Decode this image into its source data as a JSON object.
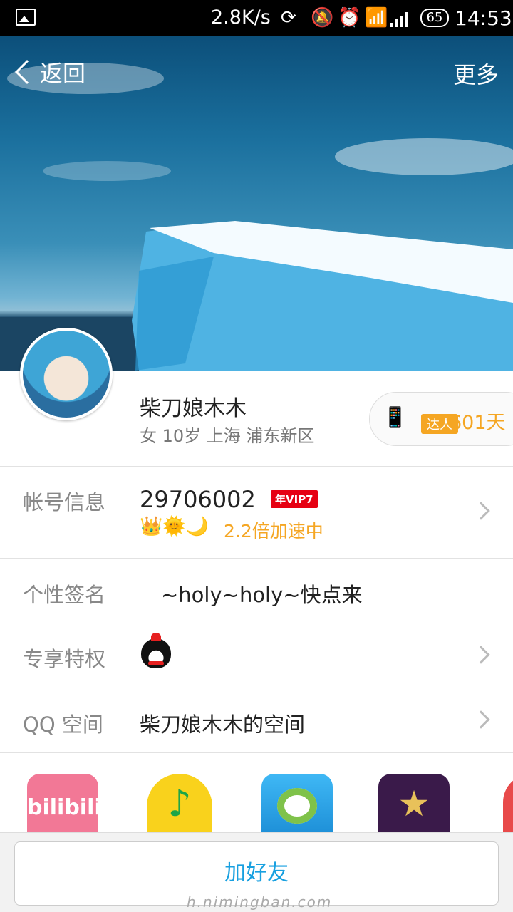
{
  "status_bar": {
    "net_speed": "2.8K/s",
    "battery": "65",
    "time": "14:53",
    "icons": [
      "image-icon",
      "sync-icon",
      "mute-icon",
      "alarm-icon",
      "wifi-icon",
      "signal-icon",
      "battery-icon"
    ]
  },
  "header": {
    "back_label": "返回",
    "more_label": "更多"
  },
  "profile": {
    "nickname": "柴刀娘木木",
    "details": "女 10岁 上海 浦东新区",
    "daren": {
      "tag": "达人",
      "days": "601天"
    }
  },
  "rows": {
    "account": {
      "label": "帐号信息",
      "qq_number": "29706002",
      "vip_badge": "年VIP7",
      "level_badges": "👑🌞🌙",
      "speedup": "2.2倍加速中"
    },
    "signature": {
      "label": "个性签名",
      "value": "~holy~holy~快点来"
    },
    "privilege": {
      "label": "专享特权"
    },
    "qzone": {
      "label": "QQ 空间",
      "value": "柴刀娘木木的空间"
    }
  },
  "apps": {
    "bilibili_text": "bilibili",
    "items": [
      "bilibili-app-icon",
      "qq-music-app-icon",
      "game-app-icon",
      "star-app-icon",
      "red-app-icon"
    ]
  },
  "footer": {
    "add_friend_label": "加好友"
  },
  "watermark": "h.nimingban.com",
  "colors": {
    "accent_blue": "#18a0e0",
    "orange": "#f5a623",
    "vip_red": "#e60012"
  }
}
